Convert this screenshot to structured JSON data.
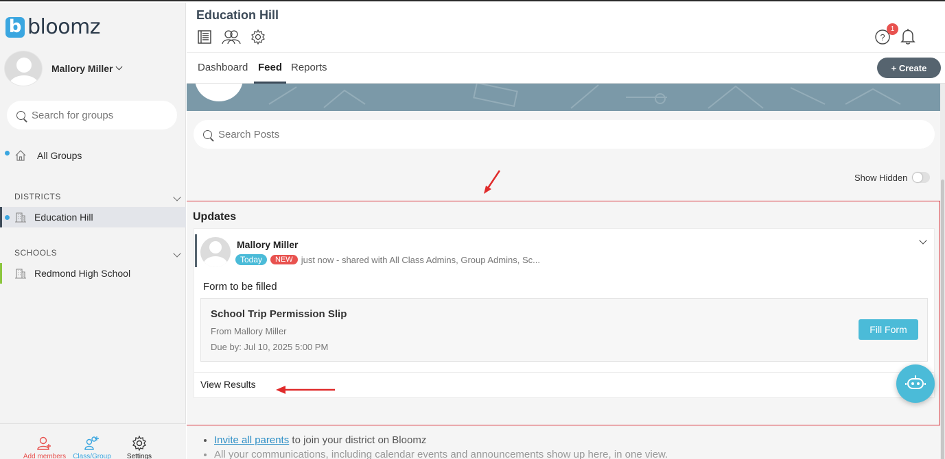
{
  "app": {
    "logo_letter": "b",
    "logo_text": "bloomz"
  },
  "sidebar": {
    "user_name": "Mallory Miller",
    "search_placeholder": "Search for groups",
    "all_groups_label": "All Groups",
    "districts_title": "DISTRICTS",
    "districts": [
      {
        "label": "Education Hill"
      }
    ],
    "schools_title": "SCHOOLS",
    "schools": [
      {
        "label": "Redmond High School"
      }
    ],
    "bottom": {
      "add_members": "Add members",
      "class_group": "Class/Group",
      "settings": "Settings"
    },
    "colors": {
      "accent": "#3aa6e0",
      "school_bar": "#8cc63e",
      "district_bar": "#3c4a58"
    }
  },
  "header": {
    "title": "Education Hill",
    "notification_count": "1",
    "icons": [
      "newsfeed-icon",
      "people-icon",
      "gear-icon",
      "help-icon",
      "bell-icon"
    ]
  },
  "tabs": {
    "items": [
      "Dashboard",
      "Feed",
      "Reports"
    ],
    "active": "Feed",
    "create_label": "+ Create"
  },
  "main": {
    "post_search_placeholder": "Search Posts",
    "show_hidden_label": "Show Hidden",
    "updates_title": "Updates",
    "post": {
      "author": "Mallory Miller",
      "today_pill": "Today",
      "new_pill": "NEW",
      "meta": "just now - shared with All Class Admins, Group Admins, Sc...",
      "body": "Form to be filled",
      "form_title": "School Trip Permission Slip",
      "form_from": "From Mallory Miller",
      "form_due": "Due by: Jul 10, 2025 5:00 PM",
      "fill_form_label": "Fill Form",
      "view_results_label": "View Results"
    },
    "footer": {
      "invite_link": "Invite all parents",
      "invite_rest": " to join your district on Bloomz",
      "line2": "All your communications, including calendar events and announcements show up here, in one view."
    }
  }
}
